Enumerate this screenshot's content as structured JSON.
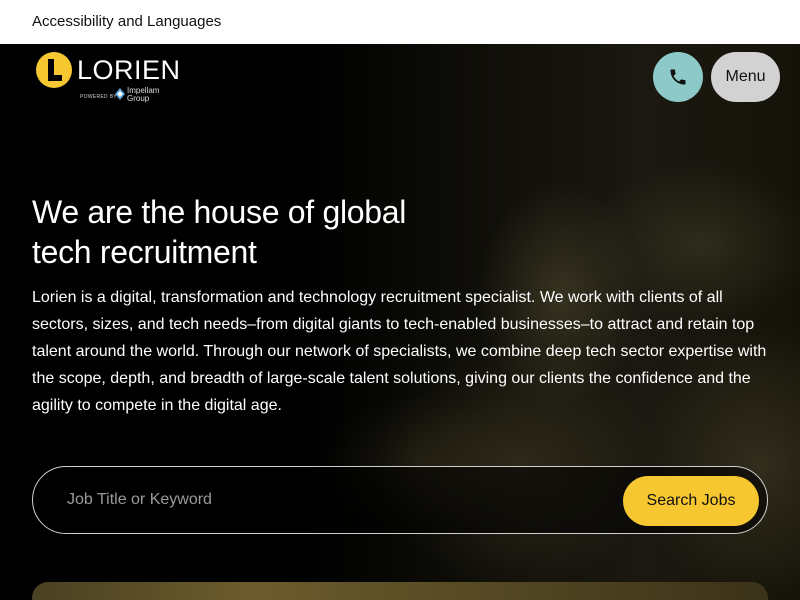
{
  "topbar": {
    "accessibility_label": "Accessibility and Languages"
  },
  "header": {
    "logo_word": "LORIEN",
    "logo_powered_by": "POWERED BY",
    "logo_parent": "Impellam Group",
    "phone_icon": "phone-icon",
    "menu_label": "Menu"
  },
  "hero": {
    "headline": "We are the house of global tech recruitment",
    "intro": "Lorien is a digital, transformation and technology recruitment specialist. We work with clients of all sectors, sizes, and tech needs–from digital giants to tech-enabled businesses–to attract and retain top talent around the world. Through our network of specialists, we combine deep tech sector expertise with the scope, depth, and breadth of large-scale talent solutions, giving our clients the confidence and the agility to compete in the digital age."
  },
  "search": {
    "placeholder": "Job Title or Keyword",
    "value": "",
    "button_label": "Search Jobs"
  },
  "colors": {
    "brand_yellow": "#f6c731",
    "phone_teal": "#8ec9c9",
    "menu_gray": "#d2d2d2",
    "background": "#000000"
  }
}
